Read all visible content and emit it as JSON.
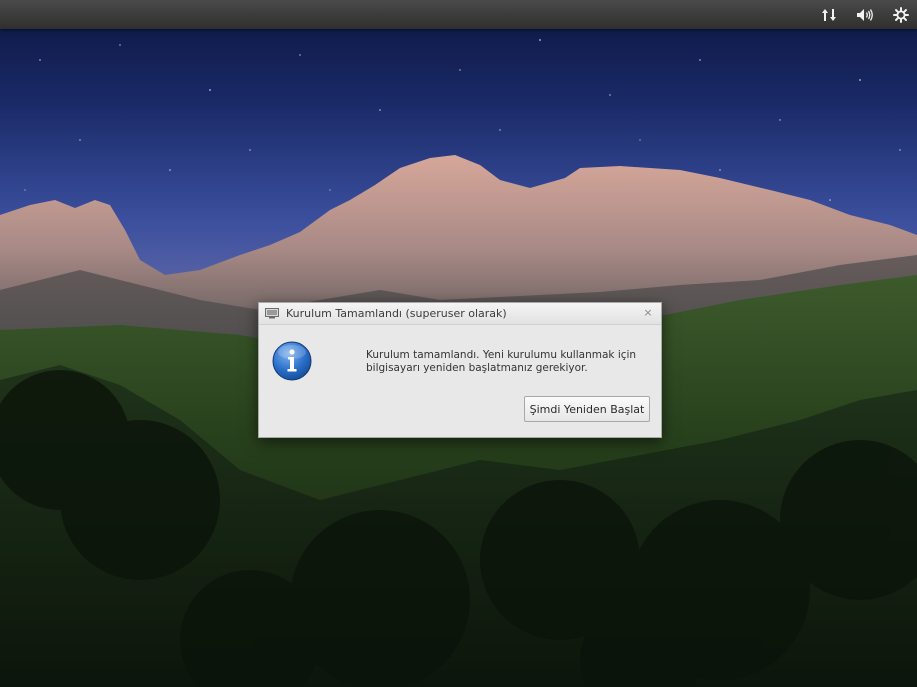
{
  "panel": {
    "tray_icons": [
      "network-transfer-icon",
      "volume-icon",
      "settings-gear-icon"
    ]
  },
  "dialog": {
    "title": "Kurulum Tamamlandı (superuser olarak)",
    "close_glyph": "×",
    "message_line1": "Kurulum tamamlandı. Yeni kurulumu kullanmak için",
    "message_line2": "bilgisayarı yeniden başlatmanız gerekiyor.",
    "icon": "info-icon",
    "restart_label": "Şimdi Yeniden Başlat"
  },
  "colors": {
    "panel": "#363636",
    "dialog_bg": "#e8e8e8",
    "info_blue": "#2a6fc9"
  }
}
